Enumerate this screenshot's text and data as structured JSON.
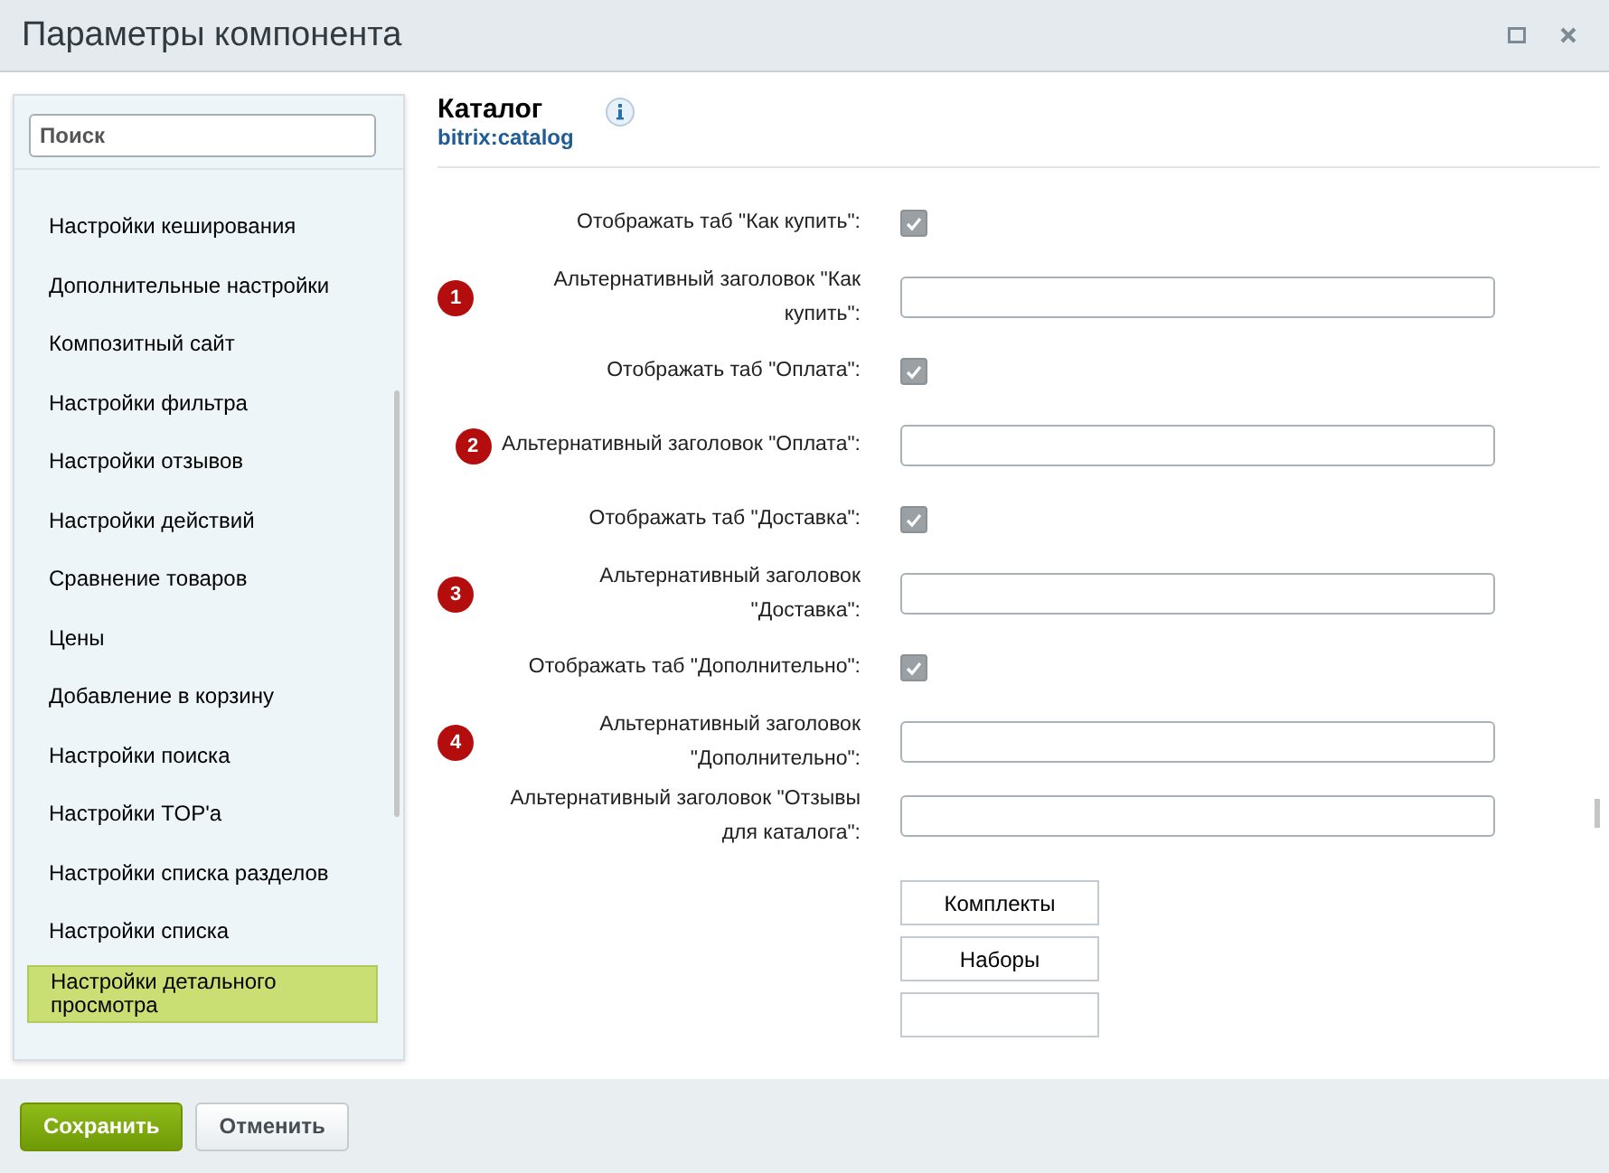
{
  "window": {
    "title": "Параметры компонента"
  },
  "sidebar": {
    "search": {
      "placeholder": "Поиск"
    },
    "items": [
      {
        "label": "Настройки кеширования",
        "selected": false
      },
      {
        "label": "Дополнительные настройки",
        "selected": false
      },
      {
        "label": "Композитный сайт",
        "selected": false
      },
      {
        "label": "Настройки фильтра",
        "selected": false
      },
      {
        "label": "Настройки отзывов",
        "selected": false
      },
      {
        "label": "Настройки действий",
        "selected": false
      },
      {
        "label": "Сравнение товаров",
        "selected": false
      },
      {
        "label": "Цены",
        "selected": false
      },
      {
        "label": "Добавление в корзину",
        "selected": false
      },
      {
        "label": "Настройки поиска",
        "selected": false
      },
      {
        "label": "Настройки TOP'а",
        "selected": false
      },
      {
        "label": "Настройки списка разделов",
        "selected": false
      },
      {
        "label": "Настройки списка",
        "selected": false
      },
      {
        "label": "Настройки детального просмотра",
        "selected": true
      }
    ]
  },
  "component": {
    "name": "Каталог",
    "code": "bitrix:catalog"
  },
  "fields": [
    {
      "kind": "checkbox",
      "label": "Отображать таб \"Как купить\":",
      "checked": true
    },
    {
      "kind": "text",
      "label": "Альтернативный заголовок \"Как купить\":",
      "badge": "1"
    },
    {
      "kind": "checkbox",
      "label": "Отображать таб \"Оплата\":",
      "checked": true
    },
    {
      "kind": "text",
      "label": "Альтернативный заголовок \"Оплата\":",
      "badge": "2"
    },
    {
      "kind": "checkbox",
      "label": "Отображать таб \"Доставка\":",
      "checked": true
    },
    {
      "kind": "text",
      "label": "Альтернативный заголовок \"Доставка\":",
      "badge": "3"
    },
    {
      "kind": "checkbox",
      "label": "Отображать таб \"Дополнительно\":",
      "checked": true
    },
    {
      "kind": "text",
      "label": "Альтернативный заголовок \"Дополнительно\":",
      "badge": "4"
    },
    {
      "kind": "text",
      "label": "Альтернативный заголовок \"Отзывы для каталога\":"
    }
  ],
  "list_buttons": [
    "Комплекты",
    "Наборы"
  ],
  "footer": {
    "save": "Сохранить",
    "cancel": "Отменить"
  }
}
